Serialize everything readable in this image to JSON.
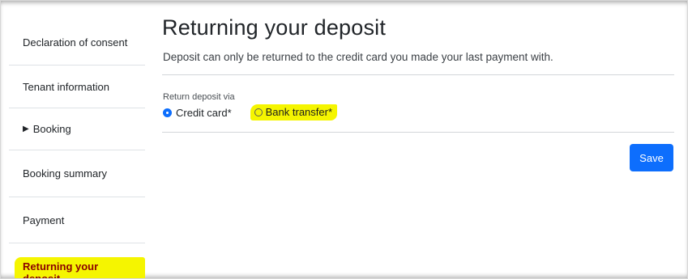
{
  "sidebar": {
    "items": [
      {
        "label": "Declaration of consent"
      },
      {
        "label": "Tenant information"
      },
      {
        "label": "Booking",
        "caret": "▶"
      },
      {
        "label": "Booking summary"
      },
      {
        "label": "Payment"
      },
      {
        "label": "Returning your deposit",
        "active": true
      }
    ]
  },
  "main": {
    "title": "Returning your deposit",
    "subtitle": "Deposit can only be returned to the credit card you made your last payment with.",
    "return_field": {
      "label": "Return deposit via",
      "options": [
        {
          "label": "Credit card*",
          "selected": true
        },
        {
          "label": "Bank transfer*",
          "selected": false
        }
      ]
    },
    "save_label": "Save"
  },
  "colors": {
    "primary": "#0d6efd",
    "highlight": "#f5f500",
    "active_text": "#8b0000"
  }
}
